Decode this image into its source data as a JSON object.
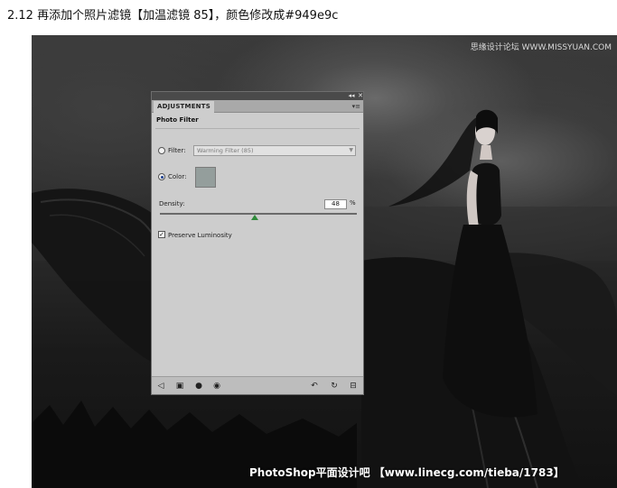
{
  "heading": "2.12 再添加个照片滤镜【加温滤镜 85】，颜色修改成#949e9c",
  "watermarks": {
    "top": "思缘设计论坛 WWW.MISSYUAN.COM",
    "bottom": "PhotoShop平面设计吧 【www.linecg.com/tieba/1783】"
  },
  "panel": {
    "tab_label": "ADJUSTMENTS",
    "title": "Photo Filter",
    "filter_label": "Filter:",
    "filter_value": "Warming Filter (85)",
    "color_label": "Color:",
    "color_value": "#949e9c",
    "selected_option": "Color",
    "density_label": "Density:",
    "density_value": "48",
    "density_unit": "%",
    "preserve_luminosity_label": "Preserve Luminosity",
    "preserve_luminosity_checked": true,
    "topbar_icons": [
      "collapse-icon",
      "close-icon"
    ],
    "footer_icons": [
      "back-arrow-icon",
      "expand-view-icon",
      "clip-to-layer-icon",
      "eye-icon",
      "previous-state-icon",
      "reset-icon",
      "trash-icon"
    ]
  }
}
